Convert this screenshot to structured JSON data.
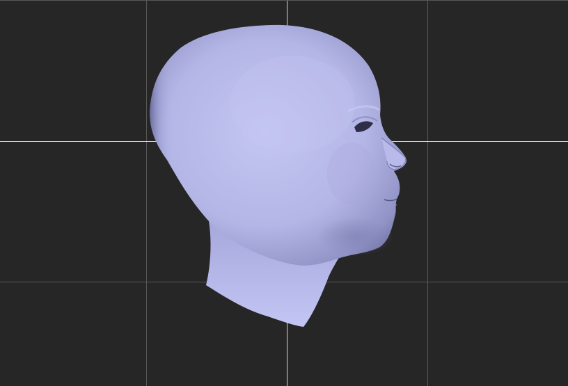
{
  "viewport": {
    "background_color": "#262626",
    "grid_line_color": "#585858",
    "axis_line_color": "#d9d9d9"
  },
  "model": {
    "type": "head-mesh",
    "orientation": "profile-right",
    "base_color": "#b6b8e8",
    "shadow_color": "#5f6190",
    "highlight_color": "#c9cbf4"
  }
}
